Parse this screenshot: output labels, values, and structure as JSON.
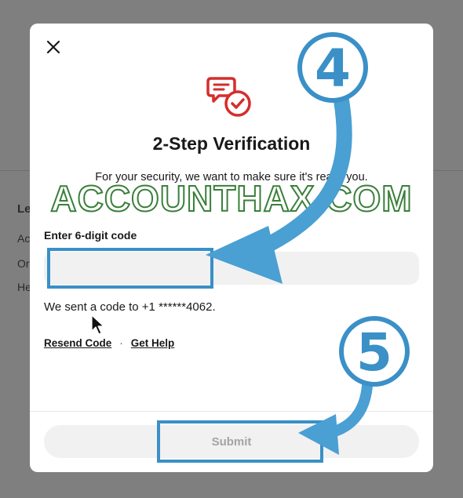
{
  "background": {
    "title": "Le",
    "lines": [
      "Ac",
      "Or",
      "He"
    ]
  },
  "modal": {
    "close_icon": "close-icon",
    "verify_icon": "message-check-icon",
    "title": "2-Step Verification",
    "subtitle": "For your security, we want to make sure it's really you.",
    "watermark": "ACCOUNTHAX.COM",
    "code_label": "Enter 6-digit code",
    "code_value": "",
    "code_placeholder": "",
    "sent_text": "We sent a code to +1 ******4062.",
    "resend_label": "Resend Code",
    "separator": "·",
    "help_label": "Get Help",
    "submit_label": "Submit"
  },
  "annotations": {
    "step_code": "4",
    "step_submit": "5"
  },
  "colors": {
    "accent_red": "#d52d2d",
    "annotation_blue": "#3a90c7",
    "submit_text_disabled": "#a4a4a4",
    "watermark_outline": "#3a7f3a"
  }
}
